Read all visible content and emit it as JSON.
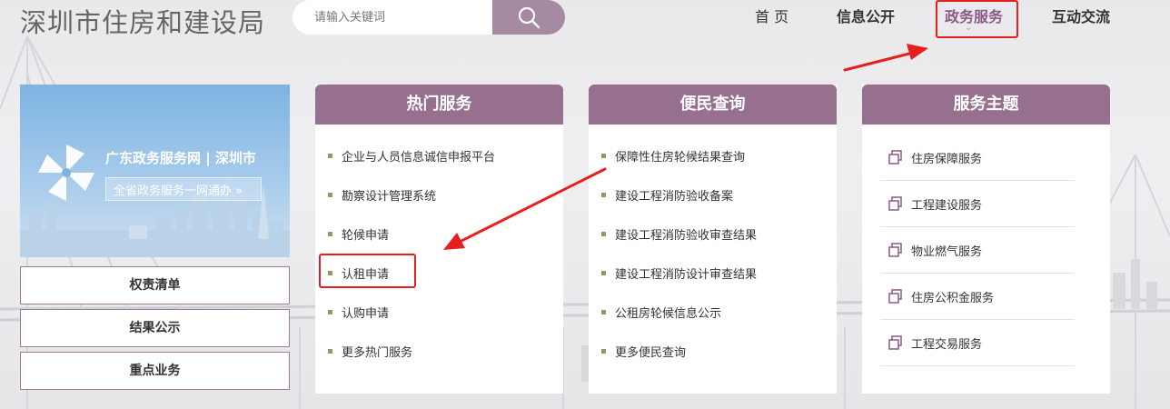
{
  "header": {
    "site_title": "深圳市住房和建设局",
    "search_placeholder": "请输入关键词",
    "nav": [
      "首 页",
      "信息公开",
      "政务服务",
      "互动交流"
    ]
  },
  "sidebar": {
    "banner_title": "广东政务服务网 | 深圳市",
    "banner_button": "全省政务服务一网通办 »",
    "buttons": [
      "权责清单",
      "结果公示",
      "重点业务"
    ]
  },
  "panels": {
    "hot": {
      "title": "热门服务",
      "items": [
        "企业与人员信息诚信申报平台",
        "勘察设计管理系统",
        "轮候申请",
        "认租申请",
        "认购申请",
        "更多热门服务"
      ]
    },
    "convenience": {
      "title": "便民查询",
      "items": [
        "保障性住房轮候结果查询",
        "建设工程消防验收备案",
        "建设工程消防验收审查结果",
        "建设工程消防设计审查结果",
        "公租房轮候信息公示",
        "更多便民查询"
      ]
    },
    "themes": {
      "title": "服务主题",
      "items": [
        "住房保障服务",
        "工程建设服务",
        "物业燃气服务",
        "住房公积金服务",
        "工程交易服务"
      ]
    }
  },
  "colors": {
    "accent": "#97708f",
    "search_button": "#a58aa1",
    "active_nav": "#8c5a86",
    "annotation": "#e61e1e",
    "bullet": "#9c9265"
  },
  "icons": {
    "search": "search-icon",
    "theme_item": "copy-icon",
    "banner_logo": "pinwheel-logo-icon"
  }
}
